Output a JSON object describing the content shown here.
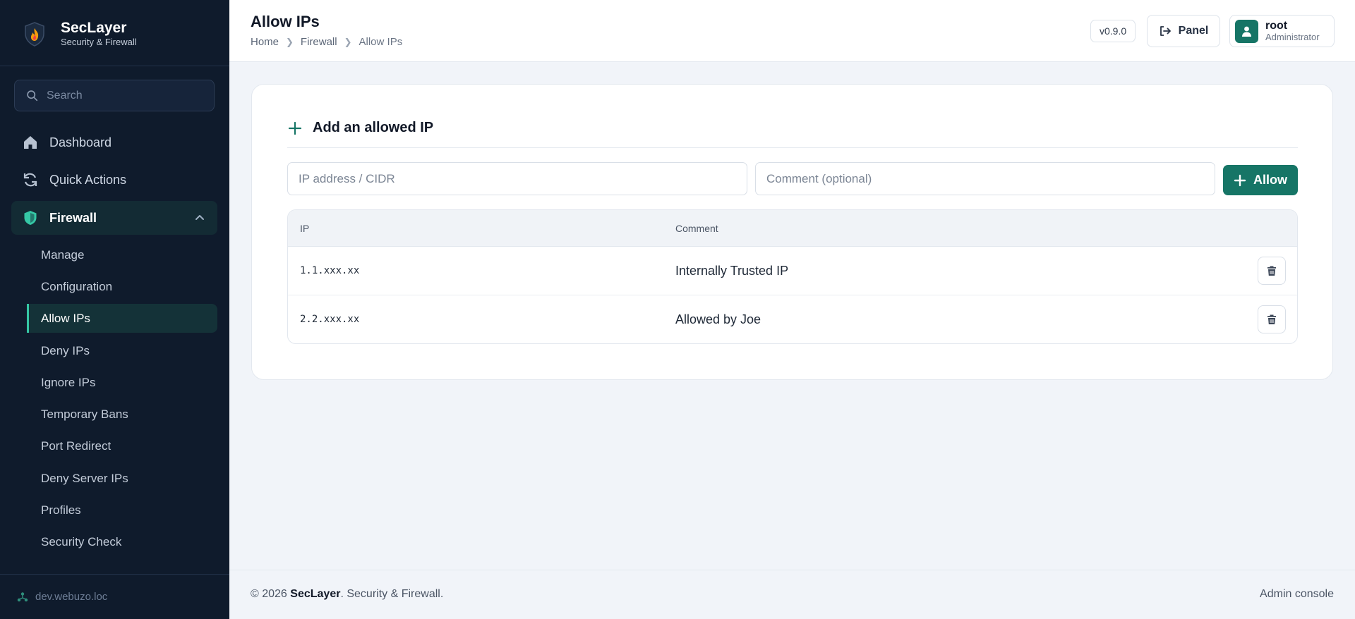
{
  "brand": {
    "name": "SecLayer",
    "tagline": "Security & Firewall"
  },
  "search": {
    "placeholder": "Search"
  },
  "nav": {
    "dashboard": "Dashboard",
    "quick_actions": "Quick Actions",
    "firewall": "Firewall",
    "firewall_sub": [
      "Manage",
      "Configuration",
      "Allow IPs",
      "Deny IPs",
      "Ignore IPs",
      "Temporary Bans",
      "Port Redirect",
      "Deny Server IPs",
      "Profiles",
      "Security Check"
    ]
  },
  "sidebar_footer": {
    "host": "dev.webuzo.loc"
  },
  "header": {
    "title": "Allow IPs",
    "breadcrumb": [
      "Home",
      "Firewall",
      "Allow IPs"
    ],
    "version": "v0.9.0",
    "panel_label": "Panel",
    "user_name": "root",
    "user_role": "Administrator"
  },
  "card": {
    "title": "Add an allowed IP",
    "ip_placeholder": "IP address / CIDR",
    "comment_placeholder": "Comment (optional)",
    "allow_label": "Allow",
    "columns": [
      "IP",
      "Comment"
    ],
    "rows": [
      {
        "ip": "1.1.xxx.xx",
        "comment": "Internally Trusted IP"
      },
      {
        "ip": "2.2.xxx.xx",
        "comment": "Allowed by Joe"
      }
    ]
  },
  "footer": {
    "copyright": "© 2026",
    "brand": "SecLayer",
    "suffix": ". Security & Firewall.",
    "right": "Admin console"
  },
  "colors": {
    "sidebar_bg": "#0f1b2c",
    "accent": "#167566",
    "accent_light": "#35c7a5",
    "page_bg": "#f1f4f9"
  }
}
